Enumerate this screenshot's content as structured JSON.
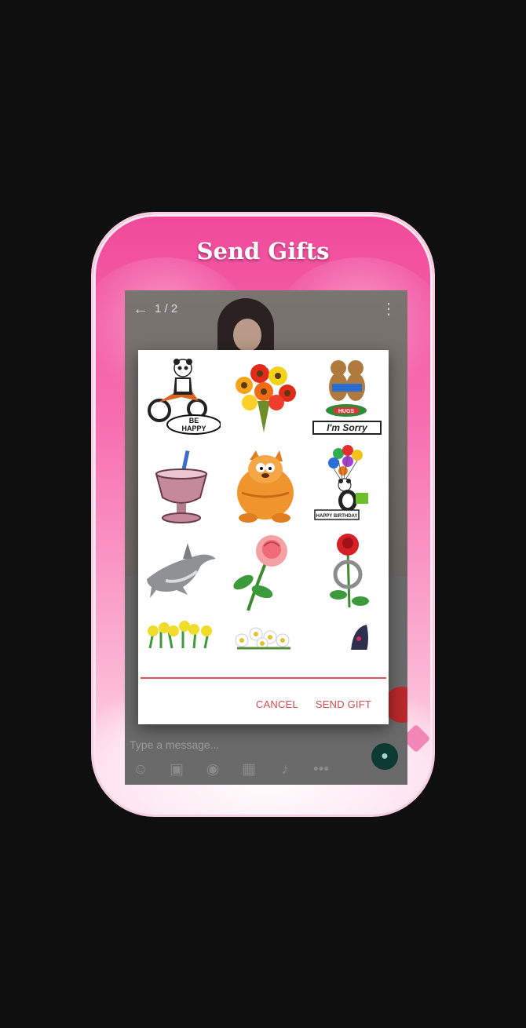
{
  "header": {
    "title": "Send Gifts"
  },
  "chat": {
    "counter": "1 / 2",
    "input_placeholder": "Type a message...",
    "back_icon": "arrow-left-icon",
    "more_icon": "more-vertical-icon",
    "toolbar_icons": [
      "emoji-icon",
      "image-icon",
      "camera-icon",
      "video-icon",
      "mic-icon",
      "more-horizontal-icon"
    ]
  },
  "dialog": {
    "gifts": [
      {
        "name": "panda-scooter",
        "caption": "BE HAPPY"
      },
      {
        "name": "flower-bouquet",
        "caption": ""
      },
      {
        "name": "bears-hug",
        "caption": "I'm Sorry"
      },
      {
        "name": "milkshake-cup",
        "caption": ""
      },
      {
        "name": "orange-cat",
        "caption": ""
      },
      {
        "name": "panda-balloons",
        "caption": "HAPPY BIRTHDAY"
      },
      {
        "name": "dolphin",
        "caption": ""
      },
      {
        "name": "pink-rose",
        "caption": ""
      },
      {
        "name": "red-rose-ring",
        "caption": ""
      },
      {
        "name": "yellow-daffodils",
        "caption": ""
      },
      {
        "name": "white-daisies",
        "caption": ""
      },
      {
        "name": "dark-gift",
        "caption": ""
      }
    ],
    "cancel_label": "CANCEL",
    "send_label": "SEND GIFT"
  },
  "colors": {
    "accent": "#e8505a",
    "pink": "#f04a9a",
    "background": "#0f0f0f"
  }
}
